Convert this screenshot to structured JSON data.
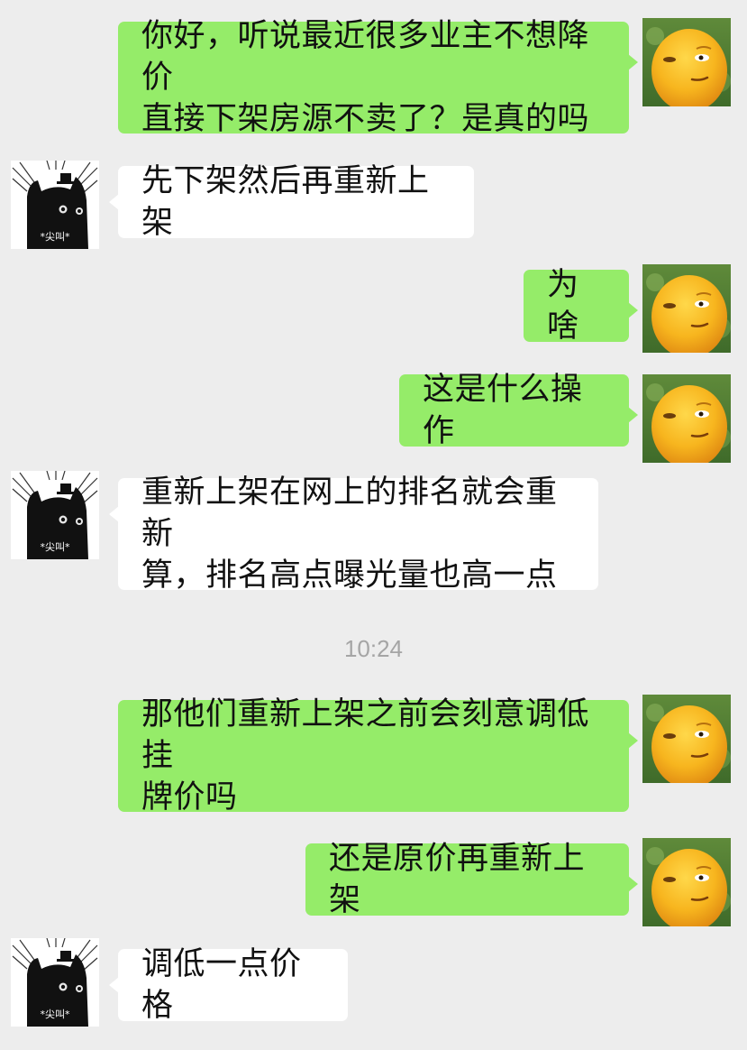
{
  "conversation": {
    "timestamp": "10:24",
    "messages": [
      {
        "side": "out",
        "text": "你好，听说最近很多业主不想降价\n直接下架房源不卖了？是真的吗"
      },
      {
        "side": "in",
        "text": "先下架然后再重新上架",
        "avatar_caption": "*尖叫*"
      },
      {
        "side": "out",
        "text": "为啥"
      },
      {
        "side": "out",
        "text": "这是什么操作"
      },
      {
        "side": "in",
        "text": "重新上架在网上的排名就会重新\n算，排名高点曝光量也高一点",
        "avatar_caption": "*尖叫*"
      },
      {
        "side": "out",
        "text": "那他们重新上架之前会刻意调低挂\n牌价吗"
      },
      {
        "side": "out",
        "text": "还是原价再重新上架"
      },
      {
        "side": "in",
        "text": "调低一点价格",
        "avatar_caption": "*尖叫*"
      }
    ]
  },
  "avatars": {
    "self": "yellow-duck-avatar",
    "other": "black-cat-avatar"
  },
  "colors": {
    "background": "#ededed",
    "outgoing_bubble": "#95ec69",
    "incoming_bubble": "#ffffff",
    "timestamp_text": "#a5a5a5"
  }
}
